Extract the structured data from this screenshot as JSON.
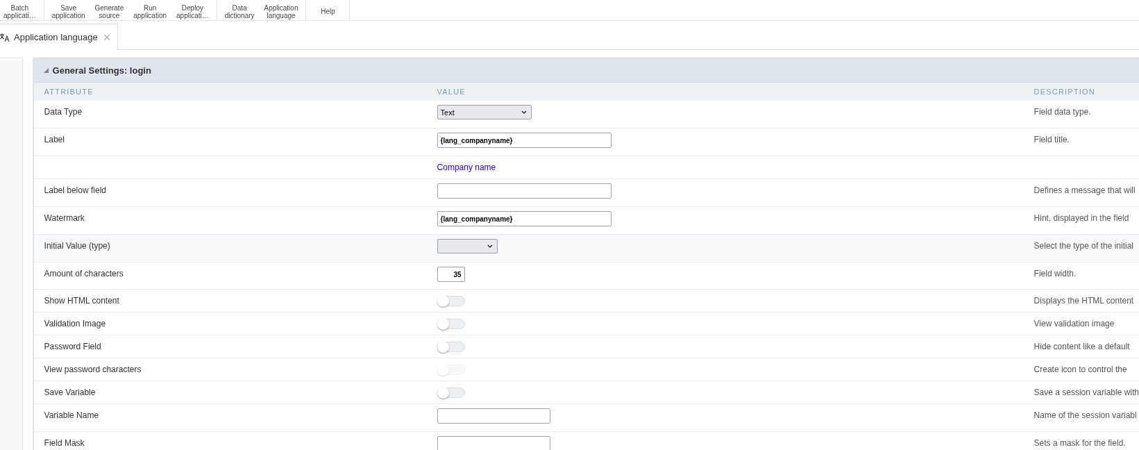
{
  "toolbar": [
    {
      "group": [
        {
          "label": "Batch\napplicati…"
        }
      ]
    },
    {
      "group": [
        {
          "label": "Save\napplication"
        },
        {
          "label": "Generate\nsource"
        },
        {
          "label": "Run\napplication"
        },
        {
          "label": "Deploy\napplicati…"
        }
      ]
    },
    {
      "group": [
        {
          "label": "Data\ndictionary"
        },
        {
          "label": "Application\nlanguage"
        }
      ]
    },
    {
      "group": [
        {
          "label": "Help"
        }
      ]
    }
  ],
  "tabs": [
    {
      "label": "Application language",
      "selected": true,
      "close": "×"
    }
  ],
  "panel": {
    "title": "General Settings: login",
    "columns": [
      "ATTRIBUTE",
      "VALUE",
      "DESCRIPTION"
    ],
    "rows": [
      {
        "attribute": "Data Type",
        "kind": "select",
        "value": "Text",
        "description": "Field data type."
      },
      {
        "attribute": "Label",
        "kind": "text",
        "value": "{lang_companyname}",
        "description": "Field title."
      },
      {
        "attribute": "",
        "kind": "note",
        "value": "Company name",
        "description": ""
      },
      {
        "attribute": "Label below field",
        "kind": "text",
        "value": "",
        "description": "Defines a message that will"
      },
      {
        "attribute": "Watermark",
        "kind": "text",
        "value": "{lang_companyname}",
        "description": "Hint, displayed in the field"
      },
      {
        "attribute": "Initial Value (type)",
        "kind": "select_small",
        "value": "",
        "description": "Select the type of the initial",
        "highlighted": true
      },
      {
        "attribute": "Amount of characters",
        "kind": "number",
        "value": "35",
        "description": "Field width."
      },
      {
        "attribute": "Show HTML content",
        "kind": "toggle",
        "on": false,
        "disabled": false,
        "description": "Displays the HTML content"
      },
      {
        "attribute": "Validation Image",
        "kind": "toggle",
        "on": false,
        "disabled": false,
        "description": "View validation image"
      },
      {
        "attribute": "Password Field",
        "kind": "toggle",
        "on": false,
        "disabled": false,
        "description": "Hide content like a default"
      },
      {
        "attribute": "View password characters",
        "kind": "toggle",
        "on": false,
        "disabled": true,
        "description": "Create icon to control the"
      },
      {
        "attribute": "Save Variable",
        "kind": "toggle",
        "on": false,
        "disabled": false,
        "description": "Save a session variable with"
      },
      {
        "attribute": "Variable Name",
        "kind": "text_short",
        "value": "",
        "description": "Name of the session variabl"
      },
      {
        "attribute": "Field Mask",
        "kind": "text_short",
        "value": "",
        "description": "Sets a mask for the field."
      }
    ]
  }
}
